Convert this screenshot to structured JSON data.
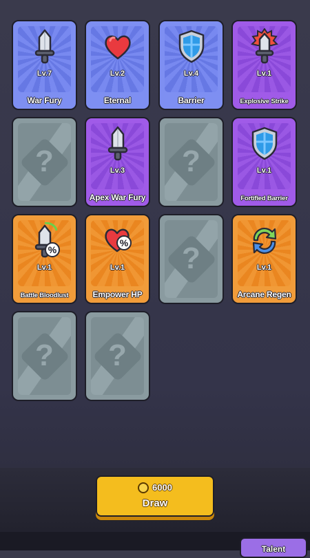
{
  "colors": {
    "blue_card": "#7e8ff2",
    "purple_card": "#a05be8",
    "orange_card": "#f19c3a",
    "locked_card": "#8a9ba0",
    "draw_button": "#f4bd1e",
    "talent_tab": "#9b6ee6"
  },
  "cards": [
    {
      "name": "War Fury",
      "level": "Lv.7",
      "rarity": "blue",
      "icon": "sword-icon"
    },
    {
      "name": "Eternal",
      "level": "Lv.2",
      "rarity": "blue",
      "icon": "heart-icon"
    },
    {
      "name": "Barrier",
      "level": "Lv.4",
      "rarity": "blue",
      "icon": "shield-icon"
    },
    {
      "name": "Explosive Strike",
      "level": "Lv.1",
      "rarity": "purple",
      "icon": "flaming-sword-icon"
    },
    {
      "name": "",
      "level": "",
      "rarity": "locked",
      "icon": "question-mark-icon"
    },
    {
      "name": "Apex War Fury",
      "level": "Lv.3",
      "rarity": "purple",
      "icon": "sword-icon"
    },
    {
      "name": "",
      "level": "",
      "rarity": "locked",
      "icon": "question-mark-icon"
    },
    {
      "name": "Fortified Barrier",
      "level": "Lv.1",
      "rarity": "purple",
      "icon": "shield-icon"
    },
    {
      "name": "Battle Bloodlust",
      "level": "Lv.1",
      "rarity": "orange",
      "icon": "sword-percent-icon"
    },
    {
      "name": "Empower HP",
      "level": "Lv.1",
      "rarity": "orange",
      "icon": "heart-percent-icon"
    },
    {
      "name": "",
      "level": "",
      "rarity": "locked",
      "icon": "question-mark-icon"
    },
    {
      "name": "Arcane Regen",
      "level": "Lv.1",
      "rarity": "orange",
      "icon": "regen-arrows-icon"
    },
    {
      "name": "",
      "level": "",
      "rarity": "locked",
      "icon": "question-mark-icon"
    },
    {
      "name": "",
      "level": "",
      "rarity": "locked",
      "icon": "question-mark-icon"
    }
  ],
  "locked_symbol": "?",
  "draw": {
    "cost": "6000",
    "label": "Draw",
    "currency_icon": "crown-coin-icon"
  },
  "tabs": {
    "talent_label": "Talent"
  }
}
